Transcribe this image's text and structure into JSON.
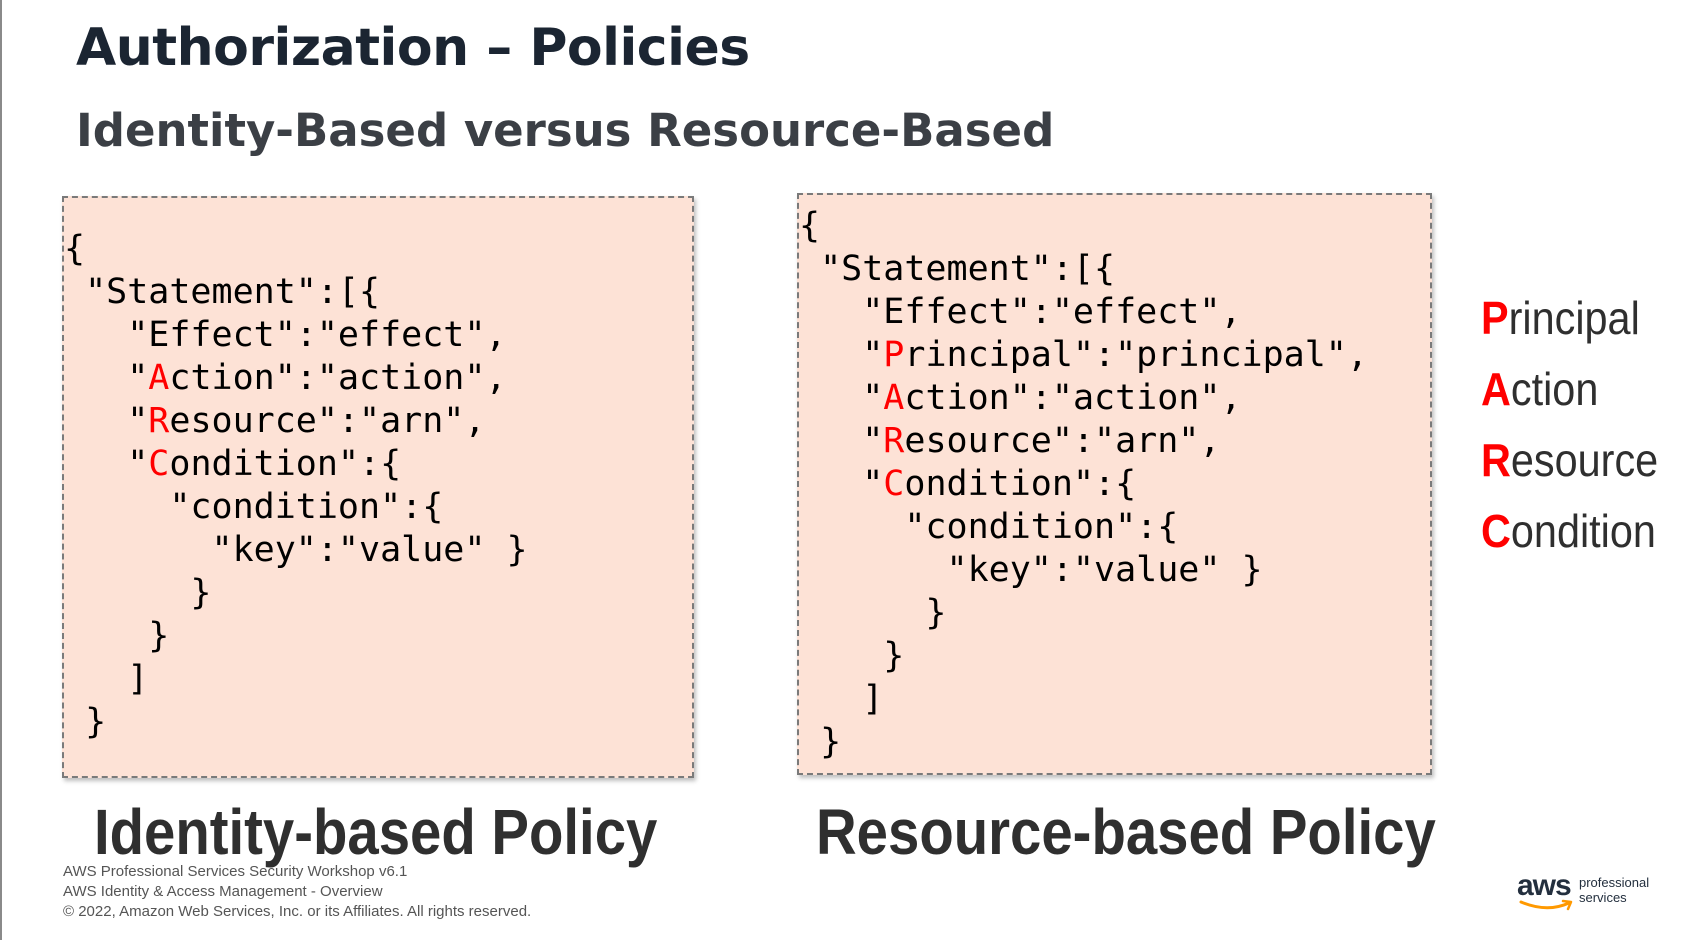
{
  "slide": {
    "title": "Authorization – Policies",
    "subtitle": "Identity-Based versus Resource-Based"
  },
  "identity_policy": {
    "caption": "Identity-based Policy",
    "code_lines": [
      {
        "hl": "",
        "rest": "{"
      },
      {
        "hl": "",
        "rest": " \"Statement\":[{"
      },
      {
        "hl": "",
        "rest": "   \"Effect\":\"effect\","
      },
      {
        "pre": "   \"",
        "hl": "A",
        "rest": "ction\":\"action\","
      },
      {
        "pre": "   \"",
        "hl": "R",
        "rest": "esource\":\"arn\","
      },
      {
        "pre": "   \"",
        "hl": "C",
        "rest": "ondition\":{"
      },
      {
        "hl": "",
        "rest": "     \"condition\":{"
      },
      {
        "hl": "",
        "rest": "       \"key\":\"value\" }"
      },
      {
        "hl": "",
        "rest": "      }"
      },
      {
        "hl": "",
        "rest": "    }"
      },
      {
        "hl": "",
        "rest": "   ]"
      },
      {
        "hl": "",
        "rest": " }"
      }
    ]
  },
  "resource_policy": {
    "caption": "Resource-based Policy",
    "code_lines": [
      {
        "hl": "",
        "rest": "{"
      },
      {
        "hl": "",
        "rest": " \"Statement\":[{"
      },
      {
        "hl": "",
        "rest": "   \"Effect\":\"effect\","
      },
      {
        "pre": "   \"",
        "hl": "P",
        "rest": "rincipal\":\"principal\","
      },
      {
        "pre": "   \"",
        "hl": "A",
        "rest": "ction\":\"action\","
      },
      {
        "pre": "   \"",
        "hl": "R",
        "rest": "esource\":\"arn\","
      },
      {
        "pre": "   \"",
        "hl": "C",
        "rest": "ondition\":{"
      },
      {
        "hl": "",
        "rest": "     \"condition\":{"
      },
      {
        "hl": "",
        "rest": "       \"key\":\"value\" }"
      },
      {
        "hl": "",
        "rest": "      }"
      },
      {
        "hl": "",
        "rest": "    }"
      },
      {
        "hl": "",
        "rest": "   ]"
      },
      {
        "hl": "",
        "rest": " }"
      }
    ]
  },
  "parc": [
    {
      "letter": "P",
      "rest": "rincipal"
    },
    {
      "letter": "A",
      "rest": "ction"
    },
    {
      "letter": "R",
      "rest": "esource"
    },
    {
      "letter": "C",
      "rest": "ondition"
    }
  ],
  "footer": {
    "line1": "AWS Professional Services Security Workshop v6.1",
    "line2": "AWS Identity & Access Management - Overview",
    "line3": "© 2022, Amazon Web Services, Inc. or its Affiliates. All rights reserved."
  },
  "logo": {
    "word": "aws",
    "line1": "professional",
    "line2": "services"
  },
  "colors": {
    "highlight": "#ff0000",
    "code_box_bg": "#fde2d6",
    "title": "#1b2532",
    "aws_smile": "#ff9900"
  }
}
